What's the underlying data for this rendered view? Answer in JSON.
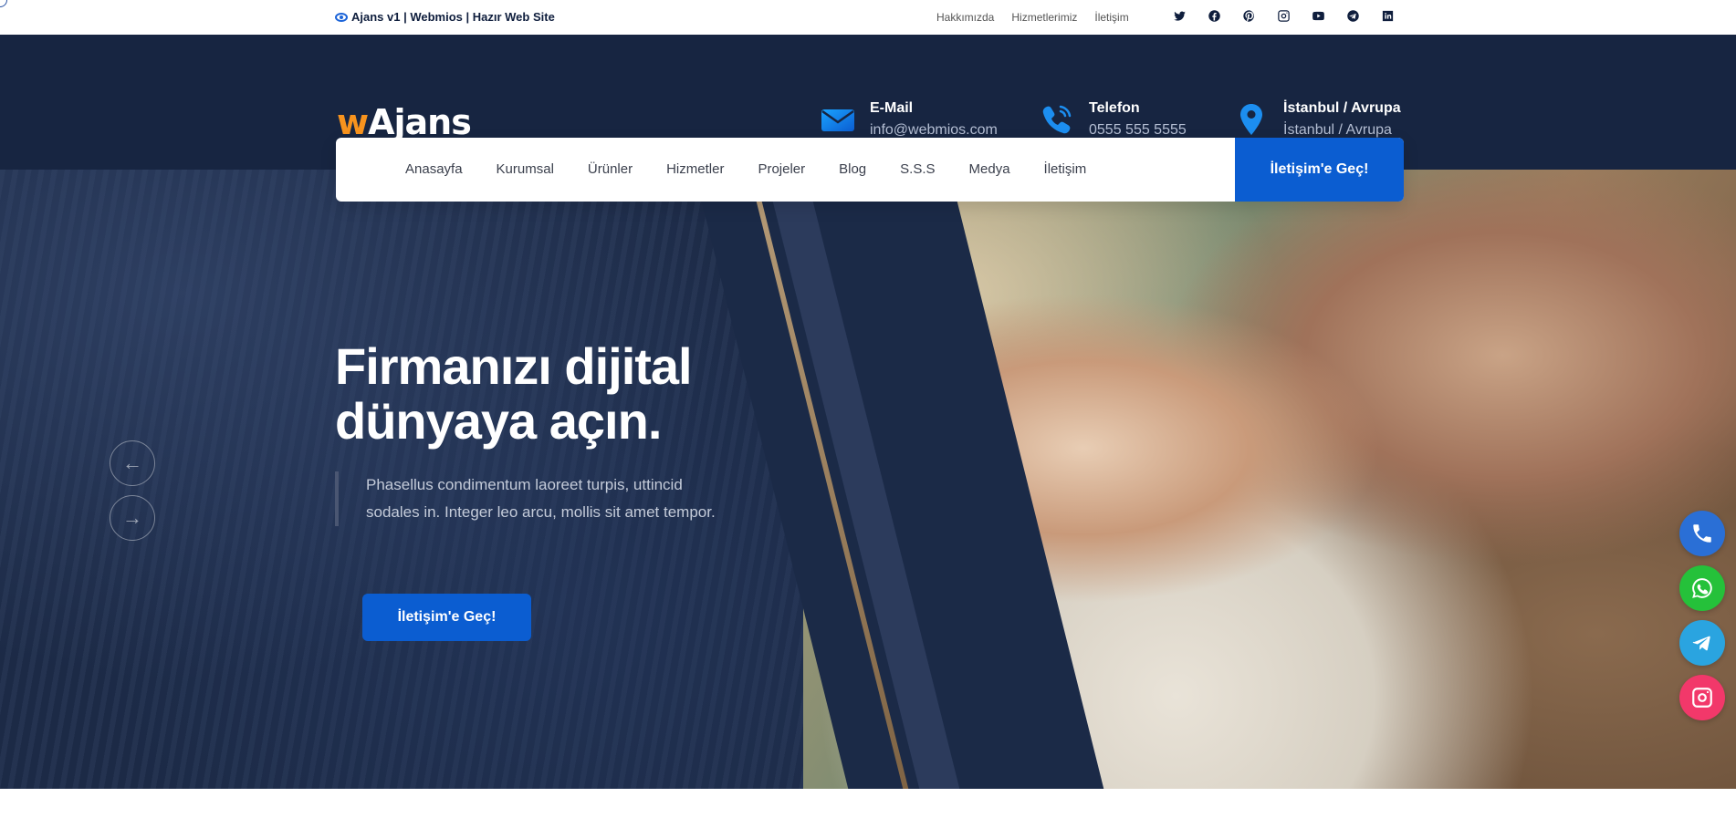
{
  "topbar": {
    "site_title": "Ajans v1 | Webmios | Hazır Web Site",
    "links": [
      "Hakkımızda",
      "Hizmetlerimiz",
      "İletişim"
    ],
    "socials": [
      "twitter-icon",
      "facebook-icon",
      "pinterest-icon",
      "instagram-icon",
      "youtube-icon",
      "telegram-icon",
      "linkedin-icon"
    ]
  },
  "header": {
    "logo_w": "w",
    "logo_text": "Ajans",
    "email": {
      "title": "E-Mail",
      "value": "info@webmios.com"
    },
    "phone": {
      "title": "Telefon",
      "value": "0555 555 5555"
    },
    "location": {
      "title": "İstanbul / Avrupa",
      "value": "İstanbul / Avrupa"
    }
  },
  "nav": {
    "items": [
      "Anasayfa",
      "Kurumsal",
      "Ürünler",
      "Hizmetler",
      "Projeler",
      "Blog",
      "S.S.S",
      "Medya",
      "İletişim"
    ],
    "cta": "İletişim'e Geç!"
  },
  "hero": {
    "heading": "Firmanızı dijital dünyaya açın.",
    "text": "Phasellus condimentum laoreet turpis, uttincid sodales in. Integer leo arcu, mollis sit amet tempor.",
    "button": "İletişim'e Geç!",
    "prev_arrow": "←",
    "next_arrow": "→"
  },
  "colors": {
    "brand_dark": "#172541",
    "accent_blue": "#0b5dd1",
    "logo_orange": "#f7931e",
    "phone_fab": "#2a6fd6",
    "whatsapp_fab": "#25c13a",
    "telegram_fab": "#2aa4e0",
    "instagram_fab": "#f2386a"
  }
}
